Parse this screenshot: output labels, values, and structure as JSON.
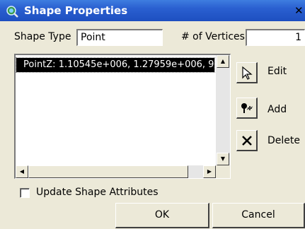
{
  "window": {
    "title": "Shape Properties",
    "close_glyph": "✕"
  },
  "form": {
    "shape_type_label": "Shape Type",
    "shape_type_value": "Point",
    "vertices_label": "# of Vertices",
    "vertices_value": "1"
  },
  "vertex_list": {
    "items": [
      "PointZ: 1.10545e+006, 1.27959e+006, 9"
    ],
    "selected_index": 0
  },
  "actions": {
    "edit_label": "Edit",
    "add_label": "Add",
    "delete_label": "Delete"
  },
  "options": {
    "update_attributes_label": "Update Shape Attributes",
    "update_attributes_checked": false
  },
  "buttons": {
    "ok_label": "OK",
    "cancel_label": "Cancel"
  },
  "icons": {
    "app": "globe-magnifier-icon",
    "edit": "pointer-arrow-icon",
    "add": "pin-add-icon",
    "delete": "x-delete-icon"
  }
}
